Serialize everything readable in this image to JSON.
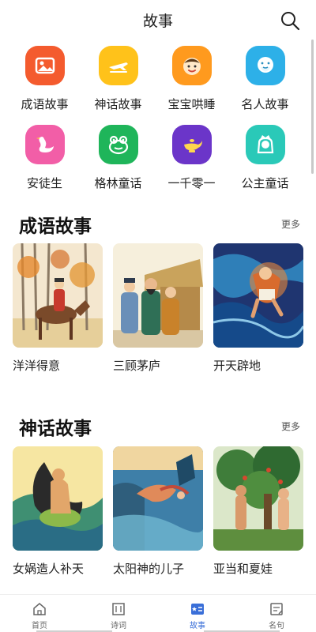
{
  "header": {
    "title": "故事",
    "search_icon": "search-icon"
  },
  "categories": [
    {
      "label": "成语故事",
      "color": "#f45b2e",
      "icon": "picture-icon"
    },
    {
      "label": "神话故事",
      "color": "#ffc21a",
      "icon": "airplane-icon"
    },
    {
      "label": "宝宝哄睡",
      "color": "#ff9a1e",
      "icon": "baby-face-icon"
    },
    {
      "label": "名人故事",
      "color": "#2db0e8",
      "icon": "sage-face-icon"
    },
    {
      "label": "安徒生",
      "color": "#f25ea7",
      "icon": "swan-icon"
    },
    {
      "label": "格林童话",
      "color": "#1fb55a",
      "icon": "frog-icon"
    },
    {
      "label": "一千零一",
      "color": "#6b35c9",
      "icon": "magic-lamp-icon"
    },
    {
      "label": "公主童话",
      "color": "#2ac9b8",
      "icon": "princess-icon"
    }
  ],
  "sections": [
    {
      "title": "成语故事",
      "more": "更多",
      "items": [
        {
          "name": "洋洋得意"
        },
        {
          "name": "三顾茅庐"
        },
        {
          "name": "开天辟地"
        }
      ]
    },
    {
      "title": "神话故事",
      "more": "更多",
      "items": [
        {
          "name": "女娲造人补天"
        },
        {
          "name": "太阳神的儿子"
        },
        {
          "name": "亚当和夏娃"
        }
      ]
    }
  ],
  "tabbar": {
    "active_color": "#3a6fd8",
    "items": [
      {
        "label": "首页",
        "icon": "home-icon"
      },
      {
        "label": "诗词",
        "icon": "scroll-icon"
      },
      {
        "label": "故事",
        "icon": "story-book-icon",
        "active": true
      },
      {
        "label": "名句",
        "icon": "quote-note-icon"
      }
    ]
  }
}
